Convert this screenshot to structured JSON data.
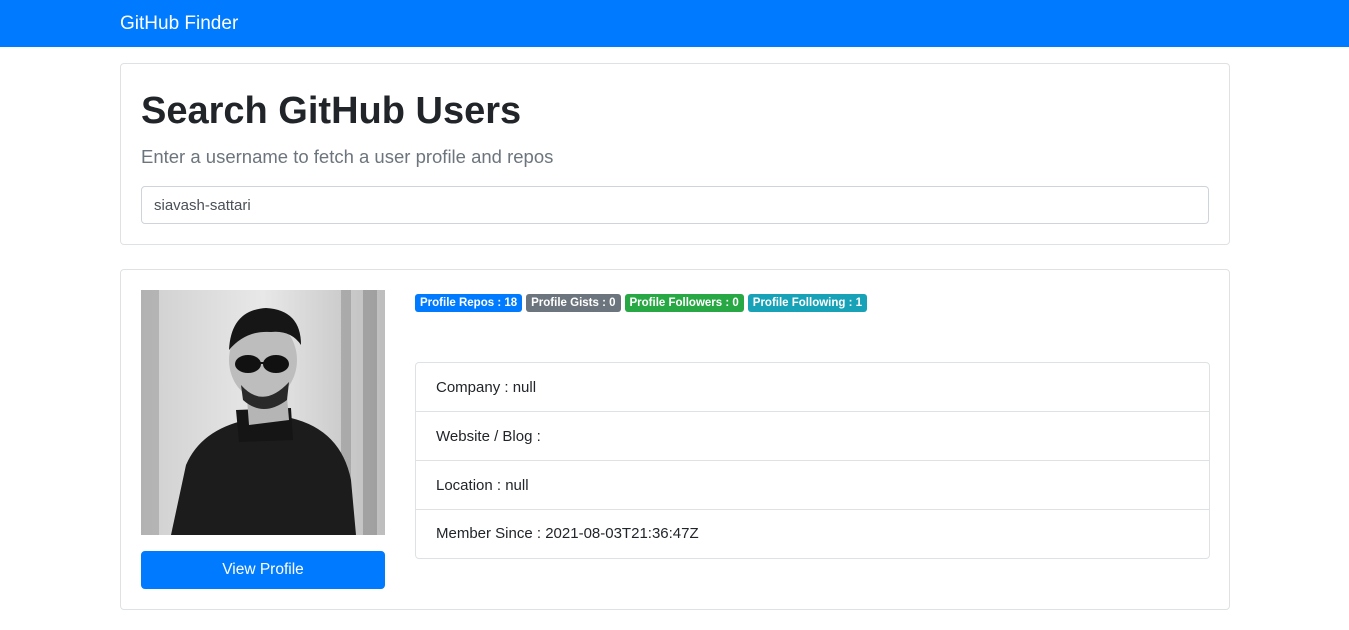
{
  "navbar": {
    "brand": "GitHub Finder"
  },
  "search": {
    "title": "Search GitHub Users",
    "lead": "Enter a username to fetch a user profile and repos",
    "input_value": "siavash-sattari"
  },
  "profile": {
    "view_button": "View Profile",
    "badges": [
      {
        "label": "Profile Repos : 18",
        "color": "#007bff"
      },
      {
        "label": "Profile Gists : 0",
        "color": "#6c757d"
      },
      {
        "label": "Profile Followers : 0",
        "color": "#28a745"
      },
      {
        "label": "Profile Following : 1",
        "color": "#17a2b8"
      }
    ],
    "details": [
      "Company : null",
      "Website / Blog :",
      "Location : null",
      "Member Since : 2021-08-03T21:36:47Z"
    ]
  },
  "colors": {
    "primary": "#007bff",
    "secondary": "#6c757d",
    "success": "#28a745",
    "info": "#17a2b8"
  }
}
